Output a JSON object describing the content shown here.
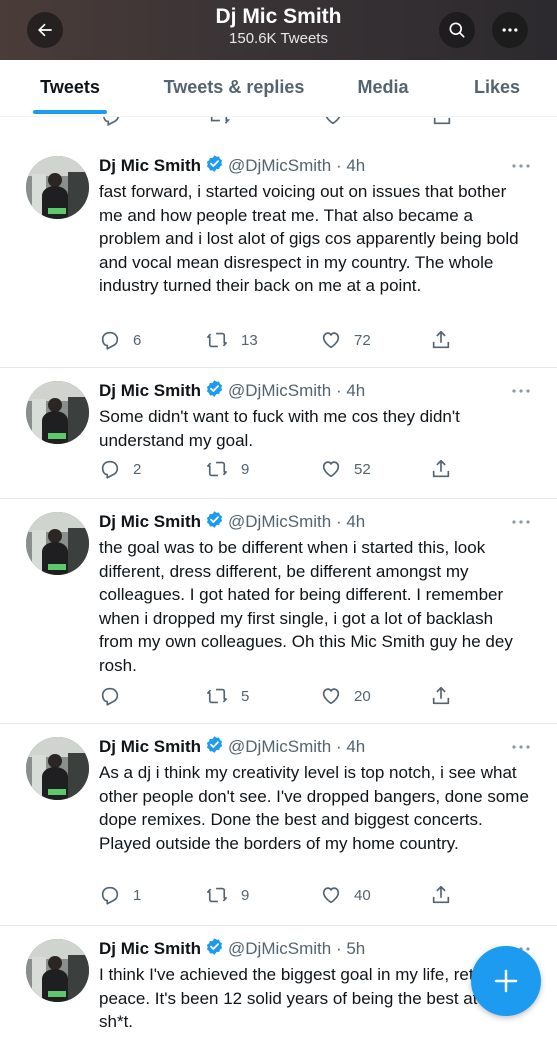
{
  "header": {
    "title": "Dj Mic Smith",
    "subtitle": "150.6K Tweets"
  },
  "tabs": [
    {
      "label": "Tweets"
    },
    {
      "label": "Tweets & replies"
    },
    {
      "label": "Media"
    },
    {
      "label": "Likes"
    }
  ],
  "tweets": [
    {
      "name": "Dj Mic Smith",
      "handle": "@DjMicSmith",
      "time": "4h",
      "text": "fast forward, i started voicing out on issues that bother me and how people treat me. That also became a problem and i lost alot of gigs cos apparently being bold and vocal mean disrespect in my country. The whole industry turned their back on me at a point.",
      "replies": "6",
      "retweets": "13",
      "likes": "72"
    },
    {
      "name": "Dj Mic Smith",
      "handle": "@DjMicSmith",
      "time": "4h",
      "text": "Some didn't want to fuck with me cos they didn't understand my goal.",
      "replies": "2",
      "retweets": "9",
      "likes": "52"
    },
    {
      "name": "Dj Mic Smith",
      "handle": "@DjMicSmith",
      "time": "4h",
      "text": "the goal was to be different when i started this, look different, dress different, be different amongst my colleagues. I got hated for being different. I remember when i dropped my first single, i got a lot of backlash from my own colleagues. Oh this Mic Smith guy he dey rosh.",
      "replies": "",
      "retweets": "5",
      "likes": "20"
    },
    {
      "name": "Dj Mic Smith",
      "handle": "@DjMicSmith",
      "time": "4h",
      "text": "As a dj i think my creativity level is top notch, i see what other people don't see. I've dropped bangers, done some dope remixes. Done the best and biggest concerts. Played outside the borders of my home country.",
      "replies": "1",
      "retweets": "9",
      "likes": "40"
    },
    {
      "name": "Dj Mic Smith",
      "handle": "@DjMicSmith",
      "time": "5h",
      "text": "I think I've achieved the biggest goal in my life, retire in peace. It's been 12 solid years of being the best at this sh*t.",
      "replies": "",
      "retweets": "",
      "likes": ""
    }
  ],
  "colors": {
    "accent": "#1d9bf0",
    "secondary_text": "#536471"
  },
  "icons": {
    "back": "arrow-left-icon",
    "search": "search-icon",
    "more": "more-horizontal-icon",
    "verified": "verified-badge-icon",
    "reply": "reply-icon",
    "retweet": "retweet-icon",
    "like": "heart-icon",
    "share": "share-icon",
    "compose": "plus-icon"
  }
}
